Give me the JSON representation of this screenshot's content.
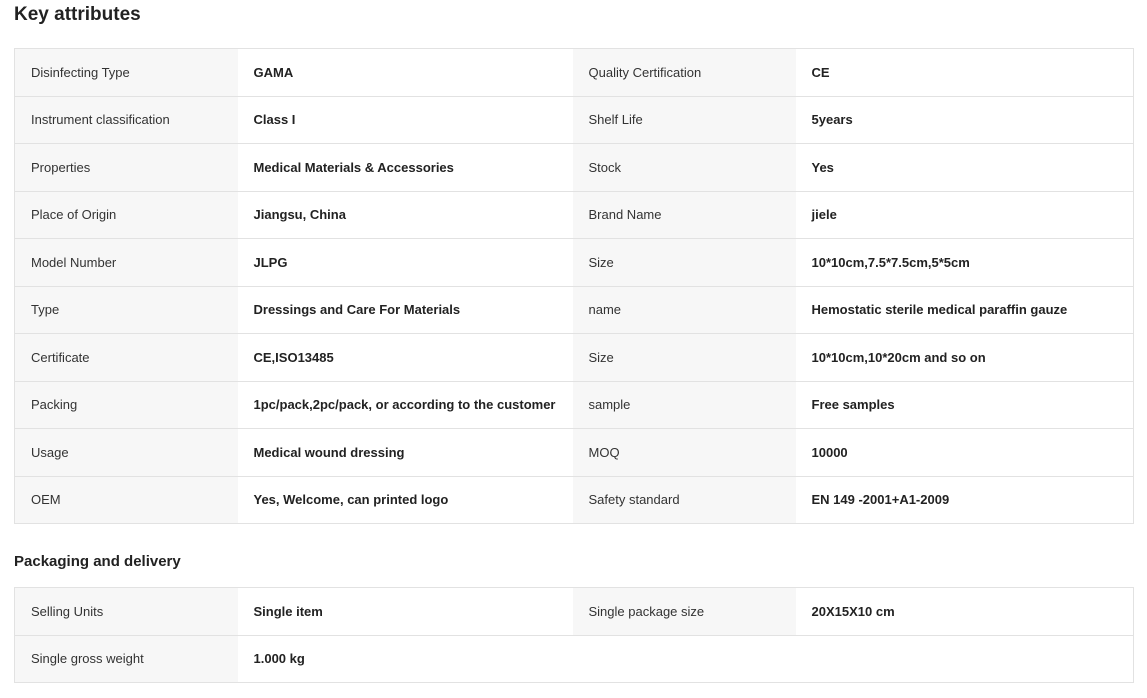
{
  "key_attributes": {
    "title": "Key attributes",
    "rows": [
      [
        {
          "label": "Disinfecting Type",
          "value": "GAMA"
        },
        {
          "label": "Quality Certification",
          "value": "CE"
        }
      ],
      [
        {
          "label": "Instrument classification",
          "value": "Class I"
        },
        {
          "label": "Shelf Life",
          "value": "5years"
        }
      ],
      [
        {
          "label": "Properties",
          "value": "Medical Materials & Accessories"
        },
        {
          "label": "Stock",
          "value": "Yes"
        }
      ],
      [
        {
          "label": "Place of Origin",
          "value": "Jiangsu, China"
        },
        {
          "label": "Brand Name",
          "value": "jiele"
        }
      ],
      [
        {
          "label": "Model Number",
          "value": "JLPG"
        },
        {
          "label": "Size",
          "value": "10*10cm,7.5*7.5cm,5*5cm"
        }
      ],
      [
        {
          "label": "Type",
          "value": "Dressings and Care For Materials"
        },
        {
          "label": "name",
          "value": "Hemostatic sterile medical paraffin gauze"
        }
      ],
      [
        {
          "label": "Certificate",
          "value": "CE,ISO13485"
        },
        {
          "label": "Size",
          "value": "10*10cm,10*20cm and so on"
        }
      ],
      [
        {
          "label": "Packing",
          "value": "1pc/pack,2pc/pack, or according to the customer"
        },
        {
          "label": "sample",
          "value": "Free samples"
        }
      ],
      [
        {
          "label": "Usage",
          "value": "Medical wound dressing"
        },
        {
          "label": "MOQ",
          "value": "10000"
        }
      ],
      [
        {
          "label": "OEM",
          "value": "Yes, Welcome, can printed logo"
        },
        {
          "label": "Safety standard",
          "value": "EN 149 -2001+A1-2009"
        }
      ]
    ]
  },
  "packaging_delivery": {
    "title": "Packaging and delivery",
    "rows": [
      [
        {
          "label": "Selling Units",
          "value": "Single item"
        },
        {
          "label": "Single package size",
          "value": "20X15X10 cm"
        }
      ],
      [
        {
          "label": "Single gross weight",
          "value": "1.000 kg"
        }
      ]
    ]
  },
  "colors": {
    "label_background": "#f7f7f7",
    "value_background": "#ffffff",
    "border": "#e2e2e2",
    "text": "#222222"
  }
}
